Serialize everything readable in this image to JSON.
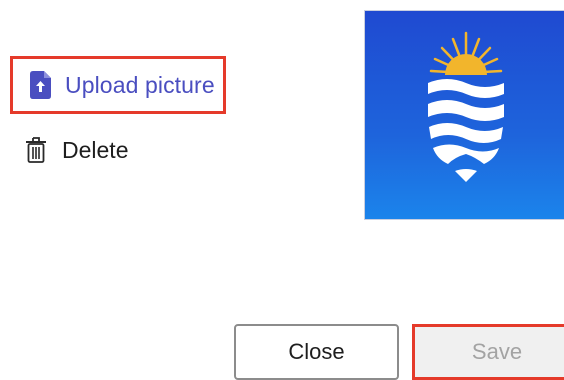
{
  "actions": {
    "upload_label": "Upload picture",
    "delete_label": "Delete"
  },
  "footer": {
    "close_label": "Close",
    "save_label": "Save"
  },
  "icons": {
    "upload": "upload-file-icon",
    "delete": "trash-icon"
  },
  "colors": {
    "accent": "#4a4ec0",
    "highlight_border": "#e53a2a",
    "logo_background": "#1e64dc",
    "sun": "#f2b52c"
  }
}
